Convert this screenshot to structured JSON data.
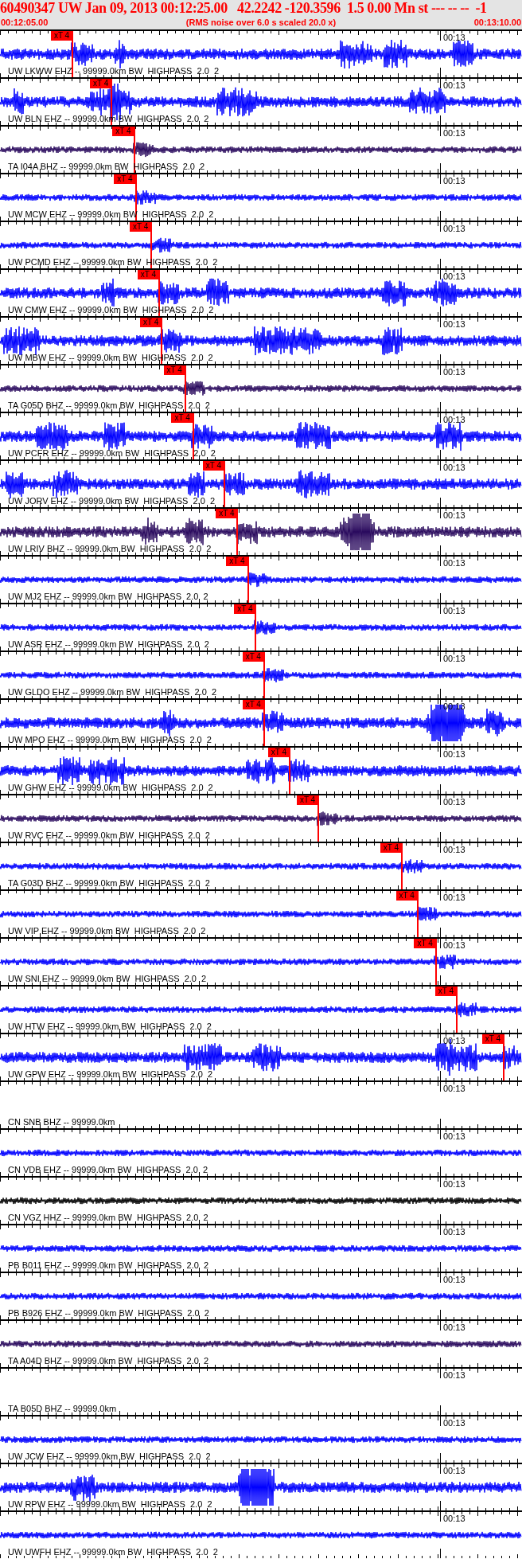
{
  "header": {
    "title": "60490347 UW Jan 09, 2013 00:12:25.00   42.2242 -120.3596  1.5 0.00 Mn st --- -- --  -1",
    "start_time": "00:12:05.00",
    "note": "(RMS noise over 6.0 s scaled 20.0 x)",
    "end_time": "00:13:10.00"
  },
  "traces": [
    {
      "label": "UW LKWW EHZ -- 99999.0km BW  HIGHPASS  2.0  2",
      "time_label": "00:13",
      "kind": "bursts",
      "color": "#0000ff",
      "pick": {
        "label": "xT 4",
        "level": 0.139
      }
    },
    {
      "label": "UW BLN EHZ -- 99999.0km BW  HIGHPASS  2.0  2",
      "time_label": "00:13",
      "kind": "bursts",
      "color": "#0000ff",
      "pick": {
        "label": "xT 4",
        "level": 0.214
      }
    },
    {
      "label": "TA I04A BHZ -- 99999.0km BW  HIGHPASS  2.0  2",
      "time_label": "00:13",
      "kind": "noise",
      "color": "#2a0a5e",
      "pick": {
        "label": "xT 4",
        "level": 0.257
      }
    },
    {
      "label": "UW MCW EHZ -- 99999.0km BW  HIGHPASS  2.0  2",
      "time_label": "00:13",
      "kind": "noise",
      "color": "#0000ff",
      "pick": {
        "label": "xT 4",
        "level": 0.26
      }
    },
    {
      "label": "UW PCMD EHZ -- 99999.0km BW  HIGHPASS  2.0  2",
      "time_label": "00:13",
      "kind": "noise",
      "color": "#0000ff",
      "pick": {
        "label": "xT 4",
        "level": 0.29
      }
    },
    {
      "label": "UW CMW EHZ -- 99999.0km BW  HIGHPASS  2.0  2",
      "time_label": "00:13",
      "kind": "bursts",
      "color": "#0000ff",
      "pick": {
        "label": "xT 4",
        "level": 0.305
      }
    },
    {
      "label": "UW MBW EHZ -- 99999.0km BW  HIGHPASS  2.0  2",
      "time_label": "00:13",
      "kind": "bursts",
      "color": "#0000ff",
      "pick": {
        "label": "xT 4",
        "level": 0.31
      }
    },
    {
      "label": "TA G05D BHZ -- 99999.0km BW  HIGHPASS  2.0  2",
      "time_label": "00:13",
      "kind": "noise",
      "color": "#2a0a5e",
      "pick": {
        "label": "xT 4",
        "level": 0.355
      }
    },
    {
      "label": "UW PCFR EHZ -- 99999.0km BW  HIGHPASS  2.0  2",
      "time_label": "00:13",
      "kind": "bursts",
      "color": "#0000ff",
      "pick": {
        "label": "xT 4",
        "level": 0.37
      }
    },
    {
      "label": "UW JORV EHZ -- 99999.0km BW  HIGHPASS  2.0  2",
      "time_label": "00:13",
      "kind": "bursts",
      "color": "#0000ff",
      "pick": {
        "label": "xT 4",
        "level": 0.43
      }
    },
    {
      "label": "UW LRIV BHZ -- 99999.0km BW  HIGHPASS  2.0  2",
      "time_label": "00:13",
      "kind": "bursts",
      "color": "#2a0a5e",
      "pick": {
        "label": "xT 4",
        "level": 0.455
      }
    },
    {
      "label": "UW MJ2 EHZ -- 99999.0km BW  HIGHPASS  2.0  2",
      "time_label": "00:13",
      "kind": "noise",
      "color": "#0000ff",
      "pick": {
        "label": "xT 4",
        "level": 0.475
      }
    },
    {
      "label": "UW ASR EHZ -- 99999.0km BW  HIGHPASS  2.0  2",
      "time_label": "00:13",
      "kind": "noise",
      "color": "#0000ff",
      "pick": {
        "label": "xT 4",
        "level": 0.49
      }
    },
    {
      "label": "UW GLDO EHZ -- 99999.0km BW  HIGHPASS  2.0  2",
      "time_label": "00:13",
      "kind": "noise",
      "color": "#0000ff",
      "pick": {
        "label": "xT 4",
        "level": 0.506
      }
    },
    {
      "label": "UW MPO EHZ -- 99999.0km BW  HIGHPASS  2.0  2",
      "time_label": "00:13",
      "kind": "bursts",
      "color": "#0000ff",
      "pick": {
        "label": "xT 4",
        "level": 0.506
      }
    },
    {
      "label": "UW GHW EHZ -- 99999.0km BW  HIGHPASS  2.0  2",
      "time_label": "00:13",
      "kind": "bursts",
      "color": "#0000ff",
      "pick": {
        "label": "xT 4",
        "level": 0.555
      }
    },
    {
      "label": "UW RVC EHZ -- 99999.0km BW  HIGHPASS  2.0  2",
      "time_label": "00:13",
      "kind": "noise",
      "color": "#2a0a5e",
      "pick": {
        "label": "xT 4",
        "level": 0.61
      }
    },
    {
      "label": "TA G03D BHZ -- 99999.0km BW  HIGHPASS  2.0  2",
      "time_label": "00:13",
      "kind": "noise",
      "color": "#0000ff",
      "pick": {
        "label": "xT 4",
        "level": 0.77
      }
    },
    {
      "label": "UW VIP EHZ -- 99999.0km BW  HIGHPASS  2.0  2",
      "time_label": "00:13",
      "kind": "noise",
      "color": "#0000ff",
      "pick": {
        "label": "xT 4",
        "level": 0.8
      }
    },
    {
      "label": "UW SNI EHZ -- 99999.0km BW  HIGHPASS  2.0  2",
      "time_label": "00:13",
      "kind": "noise",
      "color": "#0000ff",
      "pick": {
        "label": "xT 4",
        "level": 0.835
      }
    },
    {
      "label": "UW HTW EHZ -- 99999.0km BW  HIGHPASS  2.0  2",
      "kind": "noise",
      "color": "#0000ff",
      "pick": {
        "label": "xT 4",
        "level": 0.875
      }
    },
    {
      "label": "UW GPW EHZ -- 99999.0km BW  HIGHPASS  2.0  2",
      "time_label": "00:13",
      "kind": "bursts",
      "color": "#0000ff",
      "pick": {
        "label": "xT 4",
        "level": 0.965
      }
    },
    {
      "label": "CN SNB BHZ -- 99999.0km",
      "time_label": "00:13",
      "kind": "flat"
    },
    {
      "label": "CN VDB EHZ -- 99999.0km BW  HIGHPASS  2.0  2",
      "time_label": "00:13",
      "kind": "noise",
      "color": "#0000ff"
    },
    {
      "label": "CN VGZ HHZ -- 99999.0km BW  HIGHPASS  2.0  2",
      "time_label": "00:13",
      "kind": "noise",
      "color": "#000000"
    },
    {
      "label": "PB B011 EHZ -- 99999.0km BW  HIGHPASS  2.0  2",
      "time_label": "00:13",
      "kind": "noise",
      "color": "#0000ff"
    },
    {
      "label": "PB B926 EHZ -- 99999.0km BW  HIGHPASS  2.0  2",
      "time_label": "00:13",
      "kind": "noise",
      "color": "#0000ff"
    },
    {
      "label": "TA A04D BHZ -- 99999.0km BW  HIGHPASS  2.0  2",
      "time_label": "00:13",
      "kind": "noise",
      "color": "#2a0a5e"
    },
    {
      "label": "TA B05D BHZ -- 99999.0km",
      "time_label": "00:13",
      "kind": "flat"
    },
    {
      "label": "UW JCW EHZ -- 99999.0km BW  HIGHPASS  2.0  2",
      "time_label": "00:13",
      "kind": "noise",
      "color": "#0000ff"
    },
    {
      "label": "UW RPW EHZ -- 99999.0km BW  HIGHPASS  2.0  2",
      "time_label": "00:13",
      "kind": "bursts",
      "color": "#0000ff"
    },
    {
      "label": "UW UWFH EHZ -- 99999.0km BW  HIGHPASS  2.0  2",
      "time_label": "00:13",
      "kind": "noise",
      "color": "#0000ff"
    }
  ]
}
